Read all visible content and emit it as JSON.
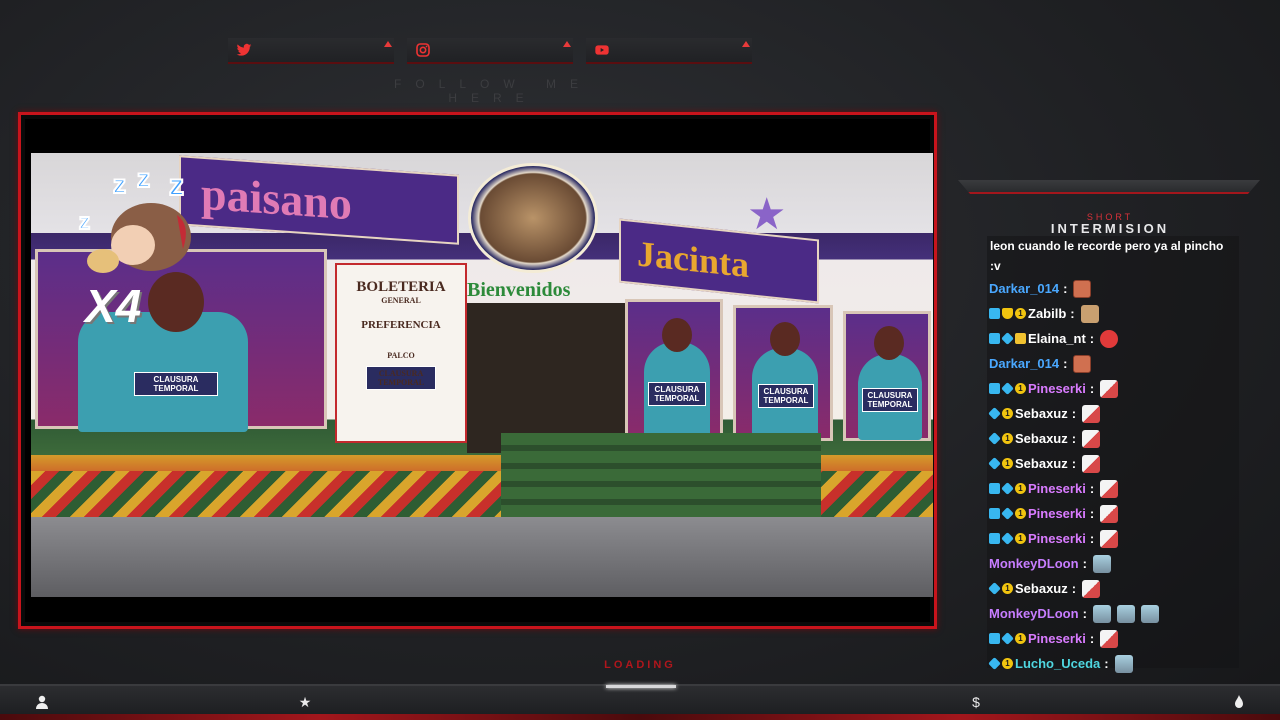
{
  "social": {
    "items": [
      {
        "name": "twitter",
        "icon": "twitter-icon"
      },
      {
        "name": "instagram",
        "icon": "instagram-icon"
      },
      {
        "name": "youtube",
        "icon": "youtube-icon"
      }
    ],
    "follow_text": "FOLLOW ME HERE"
  },
  "video": {
    "overlay_multiplier": "X4",
    "sign_paisano": "paisano",
    "sign_jacinta": "Jacinta",
    "ticket_title": "BOLETERIA",
    "ticket_general": "GENERAL",
    "ticket_preferencia": "PREFERENCIA",
    "ticket_palco": "PALCO",
    "bienvenidos": "Bienvenidos",
    "plaque_text": "CLAUSURA TEMPORAL"
  },
  "chat": {
    "header_small": "SHORT",
    "header_big": "INTERMISION",
    "first_message": "leon cuando le recorde pero ya al pincho :v",
    "messages": [
      {
        "user": "Darkar_014",
        "color": "#4aa8ff",
        "badges": [],
        "emotes": [
          "face"
        ]
      },
      {
        "user": "Zabilb",
        "color": "#ffffff",
        "badges": [
          "prime",
          "hat",
          "coin"
        ],
        "emotes": [
          "dog"
        ]
      },
      {
        "user": "Elaina_nt",
        "color": "#ffffff",
        "badges": [
          "prime",
          "gem",
          "sub"
        ],
        "emotes": [
          "red"
        ]
      },
      {
        "user": "Darkar_014",
        "color": "#4aa8ff",
        "badges": [],
        "emotes": [
          "face"
        ]
      },
      {
        "user": "Pineserki",
        "color": "#d97bff",
        "badges": [
          "prime",
          "gem",
          "coin"
        ],
        "emotes": [
          "shark"
        ]
      },
      {
        "user": "Sebaxuz",
        "color": "#ffffff",
        "badges": [
          "gem",
          "coin"
        ],
        "emotes": [
          "shark"
        ]
      },
      {
        "user": "Sebaxuz",
        "color": "#ffffff",
        "badges": [
          "gem",
          "coin"
        ],
        "emotes": [
          "shark"
        ]
      },
      {
        "user": "Sebaxuz",
        "color": "#ffffff",
        "badges": [
          "gem",
          "coin"
        ],
        "emotes": [
          "shark"
        ]
      },
      {
        "user": "Pineserki",
        "color": "#d97bff",
        "badges": [
          "prime",
          "gem",
          "coin"
        ],
        "emotes": [
          "shark"
        ]
      },
      {
        "user": "Pineserki",
        "color": "#d97bff",
        "badges": [
          "prime",
          "gem",
          "coin"
        ],
        "emotes": [
          "shark"
        ]
      },
      {
        "user": "Pineserki",
        "color": "#d97bff",
        "badges": [
          "prime",
          "gem",
          "coin"
        ],
        "emotes": [
          "shark"
        ]
      },
      {
        "user": "MonkeyDLoon",
        "color": "#c77dff",
        "badges": [],
        "emotes": [
          "group"
        ]
      },
      {
        "user": "Sebaxuz",
        "color": "#ffffff",
        "badges": [
          "gem",
          "coin"
        ],
        "emotes": [
          "shark"
        ]
      },
      {
        "user": "MonkeyDLoon",
        "color": "#c77dff",
        "badges": [],
        "emotes": [
          "group",
          "group",
          "group"
        ]
      },
      {
        "user": "Pineserki",
        "color": "#d97bff",
        "badges": [
          "prime",
          "gem",
          "coin"
        ],
        "emotes": [
          "shark"
        ]
      },
      {
        "user": "Lucho_Uceda",
        "color": "#4fd6e0",
        "badges": [
          "gem",
          "coin"
        ],
        "emotes": [
          "group"
        ]
      }
    ]
  },
  "footer": {
    "loading_text": "LOADING",
    "icons": [
      "user-icon",
      "star-icon",
      "dollar-icon",
      "flame-icon"
    ]
  },
  "colors": {
    "accent": "#c8141c",
    "background": "#1d1e21"
  }
}
